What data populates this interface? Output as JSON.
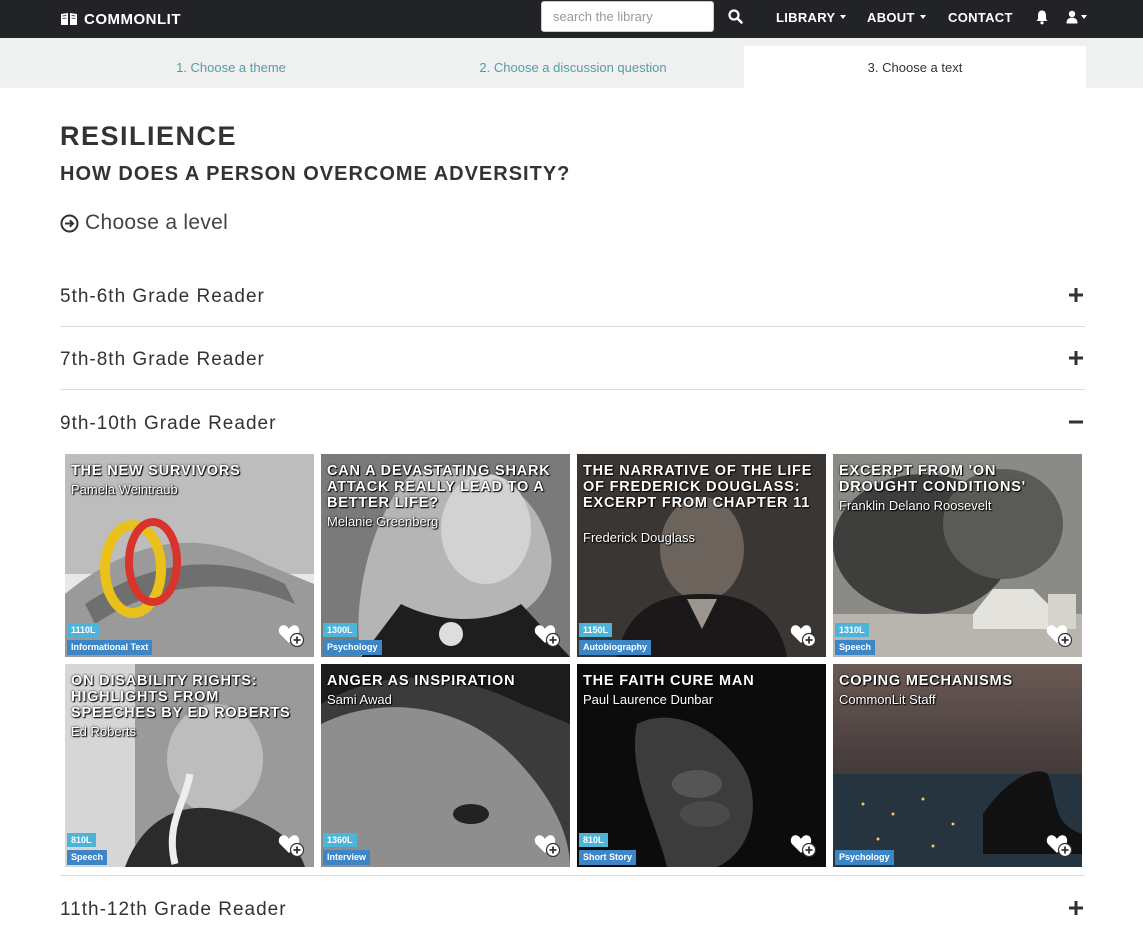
{
  "nav": {
    "brand": "COMMONLIT",
    "search_placeholder": "search the library",
    "library": "LIBRARY",
    "about": "ABOUT",
    "contact": "CONTACT"
  },
  "steps": [
    {
      "label": "1. Choose a theme"
    },
    {
      "label": "2. Choose a discussion question"
    },
    {
      "label": "3. Choose a text"
    }
  ],
  "theme": "RESILIENCE",
  "question": "HOW DOES A PERSON OVERCOME ADVERSITY?",
  "choose_level": "Choose a level",
  "levels": [
    {
      "label": "5th-6th Grade Reader",
      "expanded": false
    },
    {
      "label": "7th-8th Grade Reader",
      "expanded": false
    },
    {
      "label": "9th-10th Grade Reader",
      "expanded": true
    },
    {
      "label": "11th-12th Grade Reader",
      "expanded": false
    }
  ],
  "texts": [
    {
      "title": "THE NEW SURVIVORS",
      "author": "Pamela Weintraub",
      "lexile": "1110L",
      "genre": "Informational Text"
    },
    {
      "title": "CAN A DEVASTATING SHARK ATTACK REALLY LEAD TO A BETTER LIFE?",
      "author": "Melanie Greenberg",
      "lexile": "1300L",
      "genre": "Psychology"
    },
    {
      "title": "THE NARRATIVE OF THE LIFE OF FREDERICK DOUGLASS: EXCERPT FROM CHAPTER 11",
      "author": "Frederick Douglass",
      "lexile": "1150L",
      "genre": "Autobiography"
    },
    {
      "title": "EXCERPT FROM 'ON DROUGHT CONDITIONS'",
      "author": "Franklin Delano Roosevelt",
      "lexile": "1310L",
      "genre": "Speech"
    },
    {
      "title": "ON DISABILITY RIGHTS: HIGHLIGHTS FROM SPEECHES BY ED ROBERTS",
      "author": "Ed Roberts",
      "lexile": "810L",
      "genre": "Speech"
    },
    {
      "title": "ANGER AS INSPIRATION",
      "author": "Sami Awad",
      "lexile": "1360L",
      "genre": "Interview"
    },
    {
      "title": "THE FAITH CURE MAN",
      "author": "Paul Laurence Dunbar",
      "lexile": "810L",
      "genre": "Short Story"
    },
    {
      "title": "COPING MECHANISMS",
      "author": "CommonLit Staff",
      "lexile": "",
      "genre": "Psychology"
    }
  ],
  "colors": {
    "nav_bg": "#212327",
    "step_link": "#5a9aa8",
    "lexile_badge": "#4eb3d8",
    "genre_badge": "#3d86c6"
  }
}
